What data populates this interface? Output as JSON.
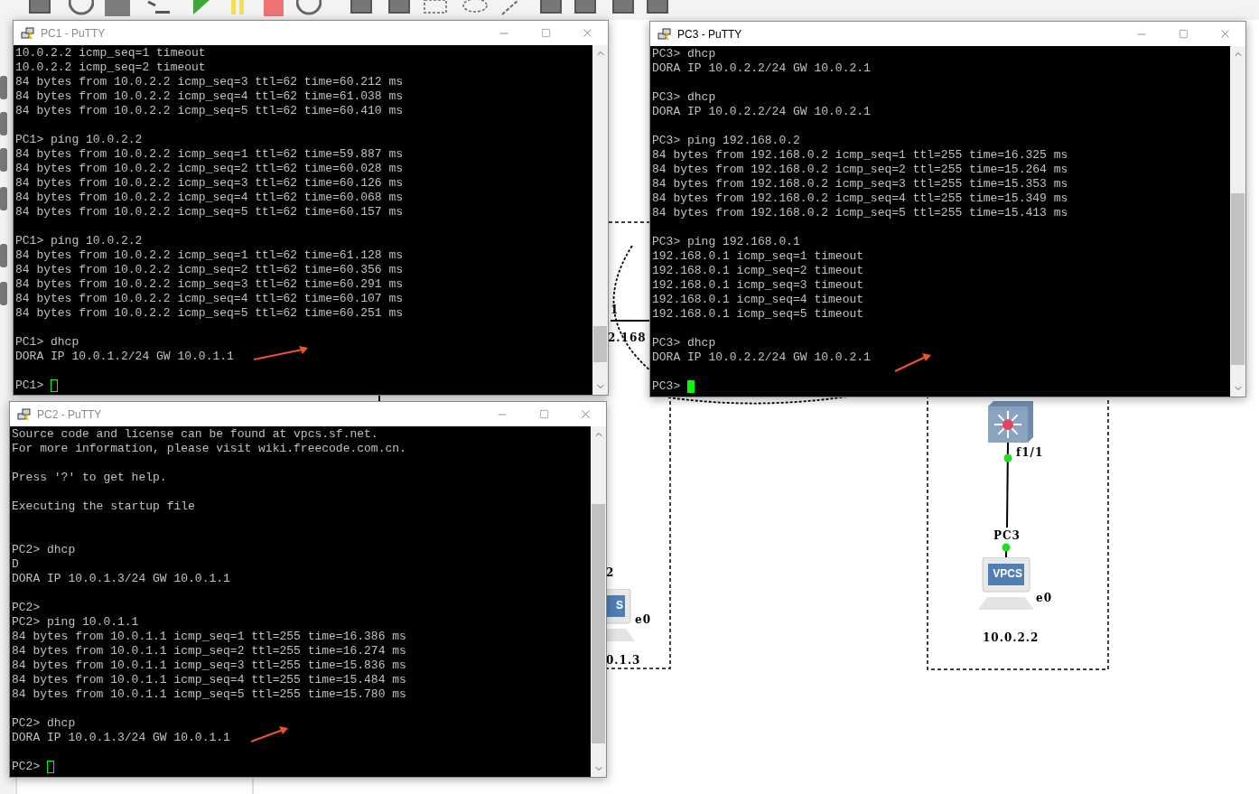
{
  "windows": [
    {
      "title": "PC1 - PuTTY",
      "active": false,
      "lines": [
        {
          "kind": "text",
          "text": "10.0.2.2 icmp_seq=1 timeout"
        },
        {
          "kind": "text",
          "text": "10.0.2.2 icmp_seq=2 timeout"
        },
        {
          "kind": "text",
          "text": "84 bytes from 10.0.2.2 icmp_seq=3 ttl=62 time=60.212 ms"
        },
        {
          "kind": "text",
          "text": "84 bytes from 10.0.2.2 icmp_seq=4 ttl=62 time=61.038 ms"
        },
        {
          "kind": "text",
          "text": "84 bytes from 10.0.2.2 icmp_seq=5 ttl=62 time=60.410 ms"
        },
        {
          "kind": "blank"
        },
        {
          "kind": "text",
          "text": "PC1> ping 10.0.2.2"
        },
        {
          "kind": "text",
          "text": "84 bytes from 10.0.2.2 icmp_seq=1 ttl=62 time=59.887 ms"
        },
        {
          "kind": "text",
          "text": "84 bytes from 10.0.2.2 icmp_seq=2 ttl=62 time=60.028 ms"
        },
        {
          "kind": "text",
          "text": "84 bytes from 10.0.2.2 icmp_seq=3 ttl=62 time=60.126 ms"
        },
        {
          "kind": "text",
          "text": "84 bytes from 10.0.2.2 icmp_seq=4 ttl=62 time=60.068 ms"
        },
        {
          "kind": "text",
          "text": "84 bytes from 10.0.2.2 icmp_seq=5 ttl=62 time=60.157 ms"
        },
        {
          "kind": "blank"
        },
        {
          "kind": "text",
          "text": "PC1> ping 10.0.2.2"
        },
        {
          "kind": "text",
          "text": "84 bytes from 10.0.2.2 icmp_seq=1 ttl=62 time=61.128 ms"
        },
        {
          "kind": "text",
          "text": "84 bytes from 10.0.2.2 icmp_seq=2 ttl=62 time=60.356 ms"
        },
        {
          "kind": "text",
          "text": "84 bytes from 10.0.2.2 icmp_seq=3 ttl=62 time=60.291 ms"
        },
        {
          "kind": "text",
          "text": "84 bytes from 10.0.2.2 icmp_seq=4 ttl=62 time=60.107 ms"
        },
        {
          "kind": "text",
          "text": "84 bytes from 10.0.2.2 icmp_seq=5 ttl=62 time=60.251 ms"
        },
        {
          "kind": "blank"
        },
        {
          "kind": "text",
          "text": "PC1> dhcp"
        },
        {
          "kind": "text",
          "text": "DORA IP 10.0.1.2/24 GW 10.0.1.1"
        },
        {
          "kind": "blank"
        },
        {
          "kind": "prompt",
          "text": "PC1>"
        }
      ]
    },
    {
      "title": "PC3 - PuTTY",
      "active": true,
      "lines": [
        {
          "kind": "text",
          "text": "PC3> dhcp"
        },
        {
          "kind": "text",
          "text": "DORA IP 10.0.2.2/24 GW 10.0.2.1"
        },
        {
          "kind": "blank"
        },
        {
          "kind": "text",
          "text": "PC3> dhcp"
        },
        {
          "kind": "text",
          "text": "DORA IP 10.0.2.2/24 GW 10.0.2.1"
        },
        {
          "kind": "blank"
        },
        {
          "kind": "text",
          "text": "PC3> ping 192.168.0.2"
        },
        {
          "kind": "text",
          "text": "84 bytes from 192.168.0.2 icmp_seq=1 ttl=255 time=16.325 ms"
        },
        {
          "kind": "text",
          "text": "84 bytes from 192.168.0.2 icmp_seq=2 ttl=255 time=15.264 ms"
        },
        {
          "kind": "text",
          "text": "84 bytes from 192.168.0.2 icmp_seq=3 ttl=255 time=15.353 ms"
        },
        {
          "kind": "text",
          "text": "84 bytes from 192.168.0.2 icmp_seq=4 ttl=255 time=15.349 ms"
        },
        {
          "kind": "text",
          "text": "84 bytes from 192.168.0.2 icmp_seq=5 ttl=255 time=15.413 ms"
        },
        {
          "kind": "blank"
        },
        {
          "kind": "text",
          "text": "PC3> ping 192.168.0.1"
        },
        {
          "kind": "text",
          "text": "192.168.0.1 icmp_seq=1 timeout"
        },
        {
          "kind": "text",
          "text": "192.168.0.1 icmp_seq=2 timeout"
        },
        {
          "kind": "text",
          "text": "192.168.0.1 icmp_seq=3 timeout"
        },
        {
          "kind": "text",
          "text": "192.168.0.1 icmp_seq=4 timeout"
        },
        {
          "kind": "text",
          "text": "192.168.0.1 icmp_seq=5 timeout"
        },
        {
          "kind": "blank"
        },
        {
          "kind": "text",
          "text": "PC3> dhcp"
        },
        {
          "kind": "text",
          "text": "DORA IP 10.0.2.2/24 GW 10.0.2.1"
        },
        {
          "kind": "blank"
        },
        {
          "kind": "prompt",
          "text": "PC3>"
        }
      ]
    },
    {
      "title": "PC2 - PuTTY",
      "active": false,
      "lines": [
        {
          "kind": "text",
          "text": "Source code and license can be found at vpcs.sf.net."
        },
        {
          "kind": "text",
          "text": "For more information, please visit wiki.freecode.com.cn."
        },
        {
          "kind": "blank"
        },
        {
          "kind": "text",
          "text": "Press '?' to get help."
        },
        {
          "kind": "blank"
        },
        {
          "kind": "text",
          "text": "Executing the startup file"
        },
        {
          "kind": "blank"
        },
        {
          "kind": "blank"
        },
        {
          "kind": "text",
          "text": "PC2> dhcp"
        },
        {
          "kind": "text",
          "text": "D"
        },
        {
          "kind": "text",
          "text": "DORA IP 10.0.1.3/24 GW 10.0.1.1"
        },
        {
          "kind": "blank"
        },
        {
          "kind": "text",
          "text": "PC2>"
        },
        {
          "kind": "text",
          "text": "PC2> ping 10.0.1.1"
        },
        {
          "kind": "text",
          "text": "84 bytes from 10.0.1.1 icmp_seq=1 ttl=255 time=16.386 ms"
        },
        {
          "kind": "text",
          "text": "84 bytes from 10.0.1.1 icmp_seq=2 ttl=255 time=16.274 ms"
        },
        {
          "kind": "text",
          "text": "84 bytes from 10.0.1.1 icmp_seq=3 ttl=255 time=15.836 ms"
        },
        {
          "kind": "text",
          "text": "84 bytes from 10.0.1.1 icmp_seq=4 ttl=255 time=15.484 ms"
        },
        {
          "kind": "text",
          "text": "84 bytes from 10.0.1.1 icmp_seq=5 ttl=255 time=15.780 ms"
        },
        {
          "kind": "blank"
        },
        {
          "kind": "text",
          "text": "PC2> dhcp"
        },
        {
          "kind": "text",
          "text": "DORA IP 10.0.1.3/24 GW 10.0.1.1"
        },
        {
          "kind": "blank"
        },
        {
          "kind": "prompt",
          "text": "PC2>"
        }
      ]
    }
  ],
  "canvas": {
    "labels": [
      {
        "text": "1"
      },
      {
        "text": "2.168"
      },
      {
        "text": "f1/1"
      },
      {
        "text": "PC3"
      },
      {
        "text": "e0"
      },
      {
        "text": "10.0.2.2"
      },
      {
        "text": "2"
      },
      {
        "text": "e0"
      },
      {
        "text": "0.1.3"
      }
    ],
    "nodes": [
      {
        "kind": "switch"
      },
      {
        "kind": "vpcs",
        "screen_text": "VPCS"
      },
      {
        "kind": "vpcs",
        "screen_text": "S"
      }
    ]
  }
}
